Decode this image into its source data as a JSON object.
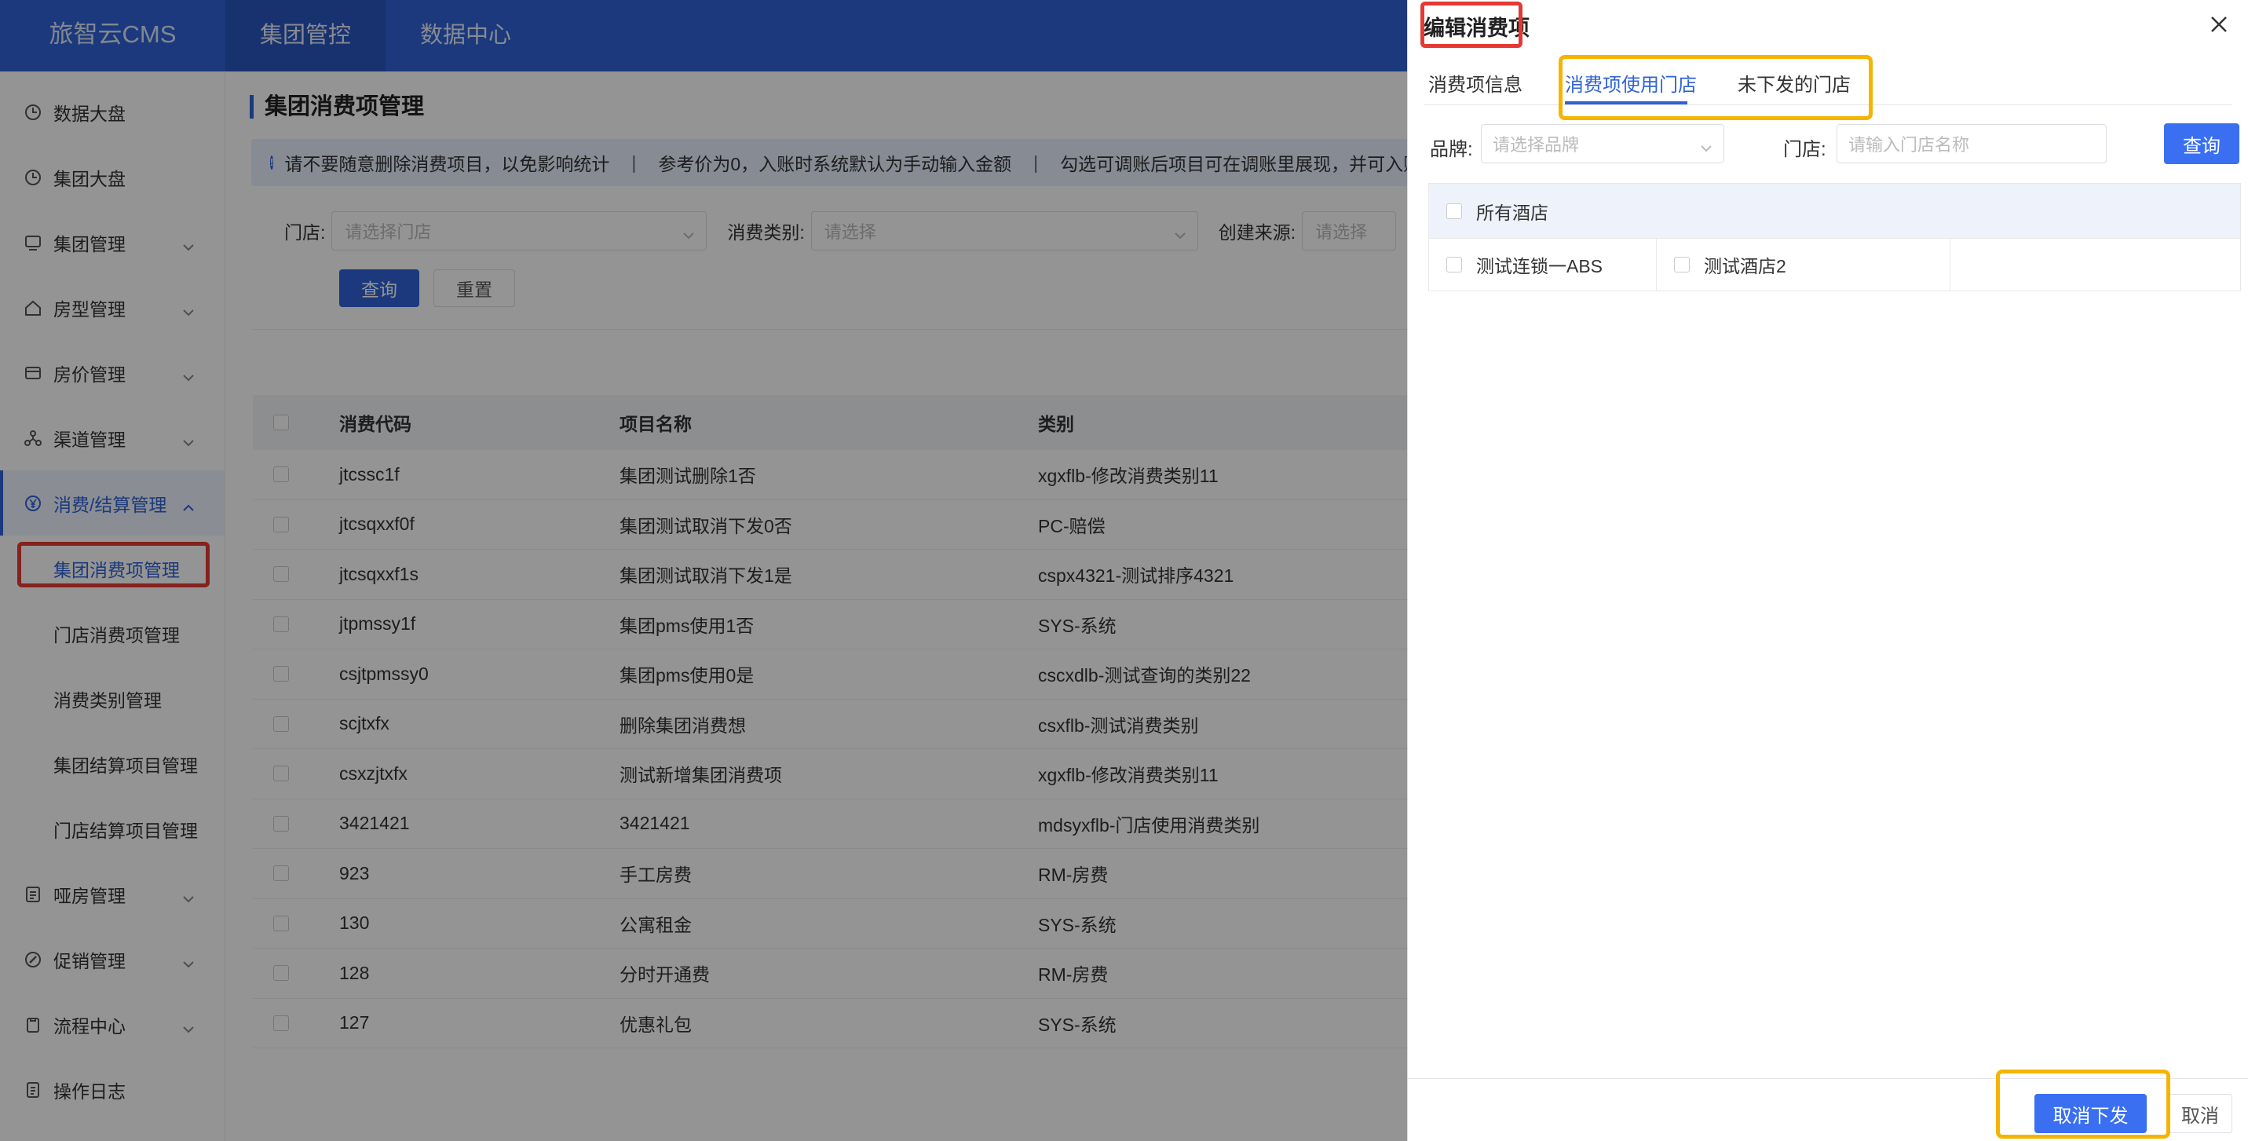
{
  "app": {
    "logo": "旅智云CMS",
    "topnav": [
      "集团管控",
      "数据中心"
    ]
  },
  "sidebar": {
    "items": [
      {
        "label": "数据大盘",
        "icon": "clock-icon"
      },
      {
        "label": "集团大盘",
        "icon": "clock-icon"
      },
      {
        "label": "集团管理",
        "icon": "monitor-icon"
      },
      {
        "label": "房型管理",
        "icon": "home-icon"
      },
      {
        "label": "房价管理",
        "icon": "card-icon"
      },
      {
        "label": "渠道管理",
        "icon": "network-icon"
      },
      {
        "label": "消费/结算管理",
        "icon": "yen-icon"
      }
    ],
    "subitems": [
      "集团消费项管理",
      "门店消费项管理",
      "消费类别管理",
      "集团结算项目管理",
      "门店结算项目管理"
    ],
    "bottom_items": [
      {
        "label": "哑房管理",
        "icon": "doc-icon"
      },
      {
        "label": "促销管理",
        "icon": "promo-icon"
      },
      {
        "label": "流程中心",
        "icon": "clipboard-icon"
      },
      {
        "label": "操作日志",
        "icon": "log-icon"
      }
    ]
  },
  "main": {
    "title": "集团消费项管理",
    "notice": [
      "请不要随意删除消费项目，以免影响统计",
      "参考价为0，入账时系统默认为手动输入金额",
      "勾选可调账后项目可在调账里展现，并可入账"
    ],
    "filters": {
      "store_label": "门店:",
      "store_placeholder": "请选择门店",
      "type_label": "消费类别:",
      "type_placeholder": "请选择",
      "source_label": "创建来源:",
      "source_placeholder": "请选择"
    },
    "query_btn": "查询",
    "reset_btn": "重置",
    "table": {
      "headers": [
        "消费代码",
        "项目名称",
        "类别"
      ],
      "rows": [
        [
          "jtcssc1f",
          "集团测试删除1否",
          "xgxflb-修改消费类别11"
        ],
        [
          "jtcsqxxf0f",
          "集团测试取消下发0否",
          "PC-赔偿"
        ],
        [
          "jtcsqxxf1s",
          "集团测试取消下发1是",
          "cspx4321-测试排序4321"
        ],
        [
          "jtpmssy1f",
          "集团pms使用1否",
          "SYS-系统"
        ],
        [
          "csjtpmssy0",
          "集团pms使用0是",
          "cscxdlb-测试查询的类别22"
        ],
        [
          "scjtxfx",
          "删除集团消费想",
          "csxflb-测试消费类别"
        ],
        [
          "csxzjtxfx",
          "测试新增集团消费项",
          "xgxflb-修改消费类别11"
        ],
        [
          "3421421",
          "3421421",
          "mdsyxflb-门店使用消费类别"
        ],
        [
          "923",
          "手工房费",
          "RM-房费"
        ],
        [
          "130",
          "公寓租金",
          "SYS-系统"
        ],
        [
          "128",
          "分时开通费",
          "RM-房费"
        ],
        [
          "127",
          "优惠礼包",
          "SYS-系统"
        ]
      ]
    }
  },
  "drawer": {
    "title": "编辑消费项",
    "tabs": [
      "消费项信息",
      "消费项使用门店",
      "未下发的门店"
    ],
    "brand_label": "品牌:",
    "brand_placeholder": "请选择品牌",
    "store_label": "门店:",
    "store_placeholder": "请输入门店名称",
    "query_btn": "查询",
    "all_hotels": "所有酒店",
    "hotels": [
      "测试连锁一ABS",
      "测试酒店2"
    ],
    "cancel_distribute_btn": "取消下发",
    "cancel_btn": "取消"
  },
  "colors": {
    "brand": "#2f62d6",
    "annotation_red": "#e53935",
    "annotation_yellow": "#f5b400"
  }
}
